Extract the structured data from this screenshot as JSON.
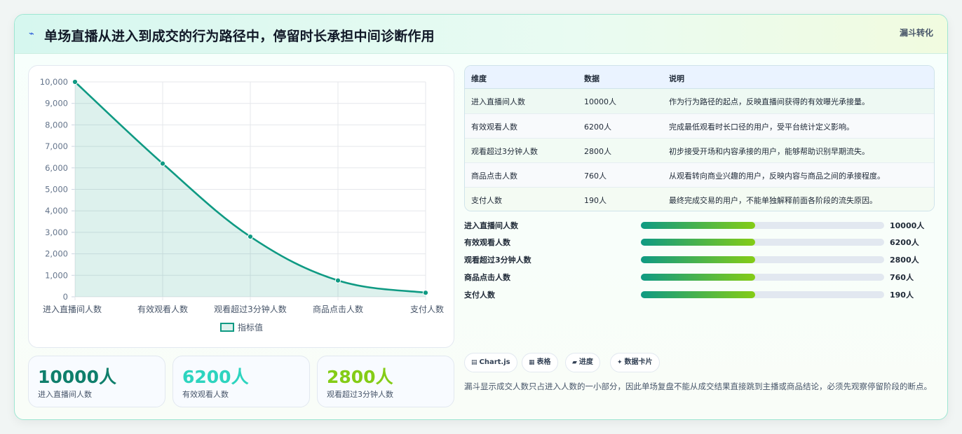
{
  "header": {
    "icon": "bolt-icon",
    "title": "单场直播从进入到成交的行为路径中，停留时长承担中间诊断作用",
    "tag": "漏斗转化"
  },
  "chart_data": {
    "type": "line",
    "categories": [
      "进入直播间人数",
      "有效观看人数",
      "观看超过3分钟人数",
      "商品点击人数",
      "支付人数"
    ],
    "series": [
      {
        "name": "指标值",
        "values": [
          10000,
          6200,
          2800,
          760,
          190
        ]
      }
    ],
    "ylim": [
      0,
      10000
    ],
    "yticks": [
      "0",
      "1,000",
      "2,000",
      "3,000",
      "4,000",
      "5,000",
      "6,000",
      "7,000",
      "8,000",
      "9,000",
      "10,000"
    ],
    "grid": true,
    "legend": "bottom",
    "color": "#0f9a83"
  },
  "kpis": [
    {
      "value": "10000人",
      "label": "进入直播间人数",
      "color": "#0f7f6c"
    },
    {
      "value": "6200人",
      "label": "有效观看人数",
      "color": "#2dd4bf"
    },
    {
      "value": "2800人",
      "label": "观看超过3分钟人数",
      "color": "#84cc16"
    }
  ],
  "table": {
    "headers": [
      "维度",
      "数据",
      "说明"
    ],
    "rows": [
      [
        "进入直播间人数",
        "10000人",
        "作为行为路径的起点，反映直播间获得的有效曝光承接量。"
      ],
      [
        "有效观看人数",
        "6200人",
        "完成最低观看时长口径的用户，受平台统计定义影响。"
      ],
      [
        "观看超过3分钟人数",
        "2800人",
        "初步接受开场和内容承接的用户，能够帮助识别早期流失。"
      ],
      [
        "商品点击人数",
        "760人",
        "从观看转向商业兴趣的用户，反映内容与商品之间的承接程度。"
      ],
      [
        "支付人数",
        "190人",
        "最终完成交易的用户，不能单独解释前面各阶段的流失原因。"
      ]
    ]
  },
  "progress": [
    {
      "label": "进入直播间人数",
      "value": "10000人",
      "fraction": 0.47
    },
    {
      "label": "有效观看人数",
      "value": "6200人",
      "fraction": 0.47
    },
    {
      "label": "观看超过3分钟人数",
      "value": "2800人",
      "fraction": 0.47
    },
    {
      "label": "商品点击人数",
      "value": "760人",
      "fraction": 0.47
    },
    {
      "label": "支付人数",
      "value": "190人",
      "fraction": 0.47
    }
  ],
  "chips": [
    {
      "icon": "chart-icon",
      "glyph": "▤",
      "label": "Chart.js"
    },
    {
      "icon": "table-icon",
      "glyph": "▦",
      "label": "表格"
    },
    {
      "icon": "progress-icon",
      "glyph": "▰",
      "label": "进度"
    },
    {
      "icon": "card-icon",
      "glyph": "✦",
      "label": "数据卡片"
    }
  ],
  "note": "漏斗显示成交人数只占进入人数的一小部分，因此单场复盘不能从成交结果直接跳到主播或商品结论，必须先观察停留阶段的断点。"
}
